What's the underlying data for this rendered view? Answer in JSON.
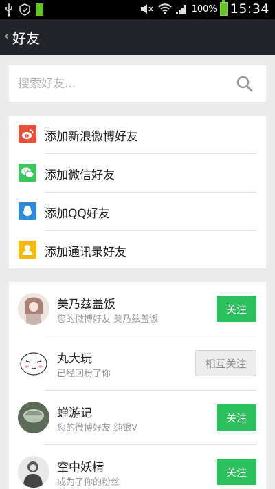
{
  "status_bar": {
    "battery_percent": "100%",
    "time": "15:34"
  },
  "nav": {
    "title": "好友"
  },
  "search": {
    "placeholder": "搜索好友..."
  },
  "add_options": [
    {
      "label": "添加新浪微博好友",
      "icon": "weibo-icon",
      "color": "#e8503a"
    },
    {
      "label": "添加微信好友",
      "icon": "wechat-icon",
      "color": "#3dc55e"
    },
    {
      "label": "添加QQ好友",
      "icon": "qq-icon",
      "color": "#2d8bd9"
    },
    {
      "label": "添加通讯录好友",
      "icon": "contacts-icon",
      "color": "#f4b80c"
    }
  ],
  "friends": [
    {
      "name": "美乃兹盖饭",
      "subtitle": "您的微博好友 美乃兹盖饭",
      "action": "关注"
    },
    {
      "name": "丸大玩",
      "subtitle": "已经回粉了你",
      "action": "相互关注"
    },
    {
      "name": "蝉游记",
      "subtitle": "您的微博好友 纯银V",
      "action": "关注"
    },
    {
      "name": "空中妖精",
      "subtitle": "成为了你的粉丝",
      "action": "关注"
    }
  ],
  "colors": {
    "follow_green": "#2bc05c",
    "navbar": "#222429"
  }
}
